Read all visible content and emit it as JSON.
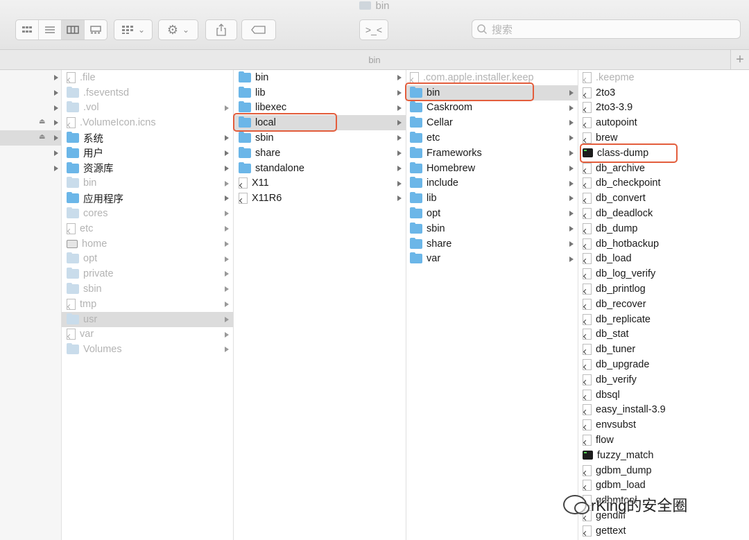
{
  "window": {
    "title": "bin"
  },
  "toolbar": {
    "view_buttons": [
      "icon-view-icon",
      "list-view-icon",
      "column-view-icon",
      "gallery-view-icon"
    ],
    "group_icon": "group-icon",
    "action_icon": "gear-icon",
    "share_icon": "share-icon",
    "tag_icon": "tag-icon",
    "terminal_glyph": ">_<",
    "search_placeholder": "搜索"
  },
  "pathbar": {
    "title": "bin"
  },
  "columns": {
    "root": [
      {
        "label": ".file",
        "hidden": true,
        "icon": "file",
        "arrow": false
      },
      {
        "label": ".fseventsd",
        "hidden": true,
        "icon": "folder",
        "arrow": false
      },
      {
        "label": ".vol",
        "hidden": true,
        "icon": "folder",
        "arrow": true
      },
      {
        "label": ".VolumeIcon.icns",
        "hidden": true,
        "icon": "file",
        "arrow": false
      },
      {
        "label": "系统",
        "hidden": false,
        "icon": "folder",
        "arrow": true
      },
      {
        "label": "用户",
        "hidden": false,
        "icon": "folder",
        "arrow": true
      },
      {
        "label": "资源库",
        "hidden": false,
        "icon": "folder",
        "arrow": true
      },
      {
        "label": "bin",
        "hidden": true,
        "icon": "folder",
        "arrow": true
      },
      {
        "label": "应用程序",
        "hidden": false,
        "icon": "folder",
        "arrow": true
      },
      {
        "label": "cores",
        "hidden": true,
        "icon": "folder",
        "arrow": true
      },
      {
        "label": "etc",
        "hidden": true,
        "icon": "file",
        "arrow": true
      },
      {
        "label": "home",
        "hidden": true,
        "icon": "disk",
        "arrow": true
      },
      {
        "label": "opt",
        "hidden": true,
        "icon": "folder",
        "arrow": true
      },
      {
        "label": "private",
        "hidden": true,
        "icon": "folder",
        "arrow": true
      },
      {
        "label": "sbin",
        "hidden": true,
        "icon": "folder",
        "arrow": true
      },
      {
        "label": "tmp",
        "hidden": true,
        "icon": "file",
        "arrow": true
      },
      {
        "label": "usr",
        "hidden": true,
        "icon": "folder",
        "arrow": true,
        "selected": true
      },
      {
        "label": "var",
        "hidden": true,
        "icon": "file",
        "arrow": true
      },
      {
        "label": "Volumes",
        "hidden": true,
        "icon": "folder",
        "arrow": true
      }
    ],
    "usr": [
      {
        "label": "bin",
        "icon": "folder",
        "arrow": true
      },
      {
        "label": "lib",
        "icon": "folder",
        "arrow": true
      },
      {
        "label": "libexec",
        "icon": "folder",
        "arrow": true
      },
      {
        "label": "local",
        "icon": "folder",
        "arrow": true,
        "selected": true
      },
      {
        "label": "sbin",
        "icon": "folder",
        "arrow": true
      },
      {
        "label": "share",
        "icon": "folder",
        "arrow": true
      },
      {
        "label": "standalone",
        "icon": "folder",
        "arrow": true
      },
      {
        "label": "X11",
        "icon": "file",
        "arrow": true
      },
      {
        "label": "X11R6",
        "icon": "file",
        "arrow": true
      }
    ],
    "local": [
      {
        "label": ".com.apple.installer.keep",
        "hidden": true,
        "icon": "file",
        "arrow": false
      },
      {
        "label": "bin",
        "icon": "folder",
        "arrow": true,
        "selected": true
      },
      {
        "label": "Caskroom",
        "icon": "folder",
        "arrow": true
      },
      {
        "label": "Cellar",
        "icon": "folder",
        "arrow": true
      },
      {
        "label": "etc",
        "icon": "folder",
        "arrow": true
      },
      {
        "label": "Frameworks",
        "icon": "folder",
        "arrow": true
      },
      {
        "label": "Homebrew",
        "icon": "folder",
        "arrow": true
      },
      {
        "label": "include",
        "icon": "folder",
        "arrow": true
      },
      {
        "label": "lib",
        "icon": "folder",
        "arrow": true
      },
      {
        "label": "opt",
        "icon": "folder",
        "arrow": true
      },
      {
        "label": "sbin",
        "icon": "folder",
        "arrow": true
      },
      {
        "label": "share",
        "icon": "folder",
        "arrow": true
      },
      {
        "label": "var",
        "icon": "folder",
        "arrow": true
      }
    ],
    "bin": [
      {
        "label": ".keepme",
        "hidden": true,
        "icon": "file"
      },
      {
        "label": "2to3",
        "icon": "file"
      },
      {
        "label": "2to3-3.9",
        "icon": "file"
      },
      {
        "label": "autopoint",
        "icon": "file"
      },
      {
        "label": "brew",
        "icon": "file"
      },
      {
        "label": "class-dump",
        "icon": "exec"
      },
      {
        "label": "db_archive",
        "icon": "file"
      },
      {
        "label": "db_checkpoint",
        "icon": "file"
      },
      {
        "label": "db_convert",
        "icon": "file"
      },
      {
        "label": "db_deadlock",
        "icon": "file"
      },
      {
        "label": "db_dump",
        "icon": "file"
      },
      {
        "label": "db_hotbackup",
        "icon": "file"
      },
      {
        "label": "db_load",
        "icon": "file"
      },
      {
        "label": "db_log_verify",
        "icon": "file"
      },
      {
        "label": "db_printlog",
        "icon": "file"
      },
      {
        "label": "db_recover",
        "icon": "file"
      },
      {
        "label": "db_replicate",
        "icon": "file"
      },
      {
        "label": "db_stat",
        "icon": "file"
      },
      {
        "label": "db_tuner",
        "icon": "file"
      },
      {
        "label": "db_upgrade",
        "icon": "file"
      },
      {
        "label": "db_verify",
        "icon": "file"
      },
      {
        "label": "dbsql",
        "icon": "file"
      },
      {
        "label": "easy_install-3.9",
        "icon": "file"
      },
      {
        "label": "envsubst",
        "icon": "file"
      },
      {
        "label": "flow",
        "icon": "file"
      },
      {
        "label": "fuzzy_match",
        "icon": "exec"
      },
      {
        "label": "gdbm_dump",
        "icon": "file"
      },
      {
        "label": "gdbm_load",
        "icon": "file"
      },
      {
        "label": "gdbmtool",
        "icon": "file"
      },
      {
        "label": "gendiff",
        "icon": "file"
      },
      {
        "label": "gettext",
        "icon": "file"
      }
    ]
  },
  "watermark": {
    "text": "rKing的安全圈"
  }
}
